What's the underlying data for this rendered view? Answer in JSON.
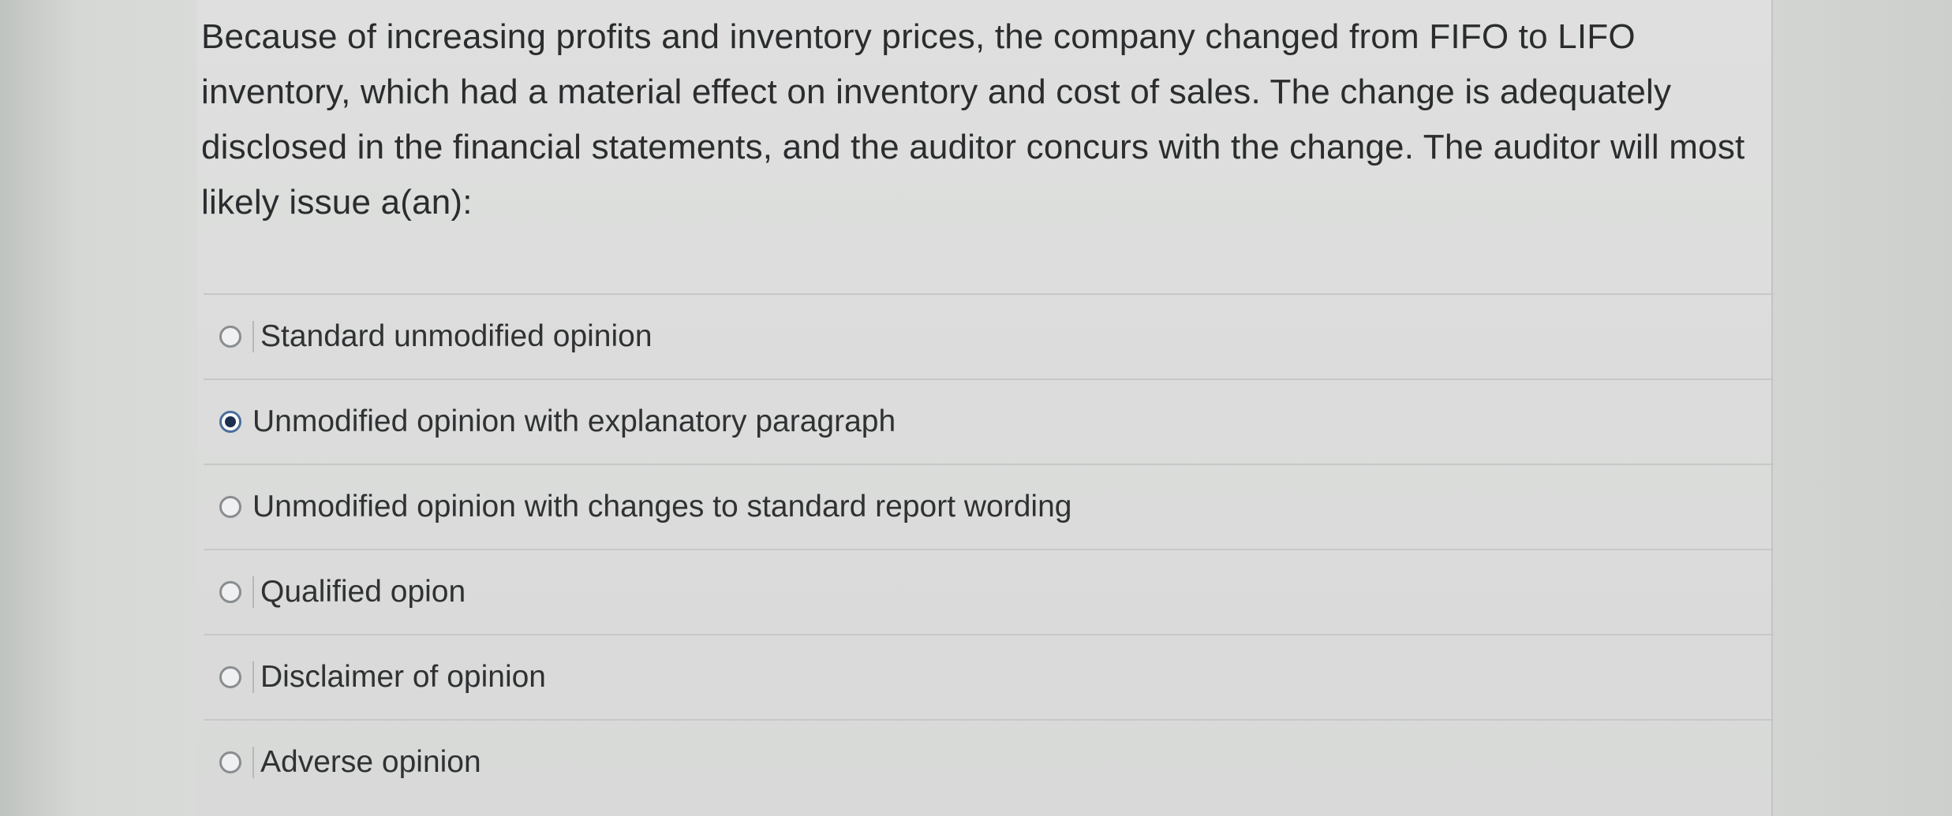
{
  "question": {
    "text": "Because of increasing profits and inventory prices, the company changed from FIFO to LIFO inventory, which had a material effect on inventory and cost of sales. The change is adequately disclosed in the financial statements, and the auditor concurs with the change. The auditor will most likely issue a(an):"
  },
  "options": [
    {
      "label": "Standard unmodified opinion",
      "selected": false
    },
    {
      "label": "Unmodified opinion with explanatory paragraph",
      "selected": true
    },
    {
      "label": "Unmodified opinion with changes to standard report wording",
      "selected": false
    },
    {
      "label": "Qualified opion",
      "selected": false
    },
    {
      "label": "Disclaimer of opinion",
      "selected": false
    },
    {
      "label": "Adverse opinion",
      "selected": false
    }
  ],
  "colors": {
    "selected_radio": "#1d2f4f",
    "panel_bg": "#dedfde"
  }
}
